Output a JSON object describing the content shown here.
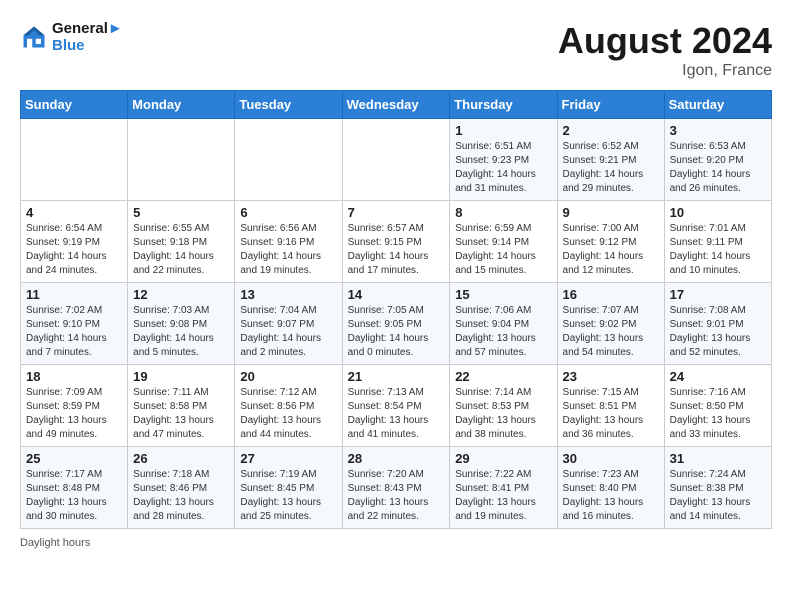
{
  "header": {
    "logo_line1": "General",
    "logo_line2": "Blue",
    "month_title": "August 2024",
    "location": "Igon, France"
  },
  "days_of_week": [
    "Sunday",
    "Monday",
    "Tuesday",
    "Wednesday",
    "Thursday",
    "Friday",
    "Saturday"
  ],
  "weeks": [
    [
      {
        "day": "",
        "info": ""
      },
      {
        "day": "",
        "info": ""
      },
      {
        "day": "",
        "info": ""
      },
      {
        "day": "",
        "info": ""
      },
      {
        "day": "1",
        "info": "Sunrise: 6:51 AM\nSunset: 9:23 PM\nDaylight: 14 hours\nand 31 minutes."
      },
      {
        "day": "2",
        "info": "Sunrise: 6:52 AM\nSunset: 9:21 PM\nDaylight: 14 hours\nand 29 minutes."
      },
      {
        "day": "3",
        "info": "Sunrise: 6:53 AM\nSunset: 9:20 PM\nDaylight: 14 hours\nand 26 minutes."
      }
    ],
    [
      {
        "day": "4",
        "info": "Sunrise: 6:54 AM\nSunset: 9:19 PM\nDaylight: 14 hours\nand 24 minutes."
      },
      {
        "day": "5",
        "info": "Sunrise: 6:55 AM\nSunset: 9:18 PM\nDaylight: 14 hours\nand 22 minutes."
      },
      {
        "day": "6",
        "info": "Sunrise: 6:56 AM\nSunset: 9:16 PM\nDaylight: 14 hours\nand 19 minutes."
      },
      {
        "day": "7",
        "info": "Sunrise: 6:57 AM\nSunset: 9:15 PM\nDaylight: 14 hours\nand 17 minutes."
      },
      {
        "day": "8",
        "info": "Sunrise: 6:59 AM\nSunset: 9:14 PM\nDaylight: 14 hours\nand 15 minutes."
      },
      {
        "day": "9",
        "info": "Sunrise: 7:00 AM\nSunset: 9:12 PM\nDaylight: 14 hours\nand 12 minutes."
      },
      {
        "day": "10",
        "info": "Sunrise: 7:01 AM\nSunset: 9:11 PM\nDaylight: 14 hours\nand 10 minutes."
      }
    ],
    [
      {
        "day": "11",
        "info": "Sunrise: 7:02 AM\nSunset: 9:10 PM\nDaylight: 14 hours\nand 7 minutes."
      },
      {
        "day": "12",
        "info": "Sunrise: 7:03 AM\nSunset: 9:08 PM\nDaylight: 14 hours\nand 5 minutes."
      },
      {
        "day": "13",
        "info": "Sunrise: 7:04 AM\nSunset: 9:07 PM\nDaylight: 14 hours\nand 2 minutes."
      },
      {
        "day": "14",
        "info": "Sunrise: 7:05 AM\nSunset: 9:05 PM\nDaylight: 14 hours\nand 0 minutes."
      },
      {
        "day": "15",
        "info": "Sunrise: 7:06 AM\nSunset: 9:04 PM\nDaylight: 13 hours\nand 57 minutes."
      },
      {
        "day": "16",
        "info": "Sunrise: 7:07 AM\nSunset: 9:02 PM\nDaylight: 13 hours\nand 54 minutes."
      },
      {
        "day": "17",
        "info": "Sunrise: 7:08 AM\nSunset: 9:01 PM\nDaylight: 13 hours\nand 52 minutes."
      }
    ],
    [
      {
        "day": "18",
        "info": "Sunrise: 7:09 AM\nSunset: 8:59 PM\nDaylight: 13 hours\nand 49 minutes."
      },
      {
        "day": "19",
        "info": "Sunrise: 7:11 AM\nSunset: 8:58 PM\nDaylight: 13 hours\nand 47 minutes."
      },
      {
        "day": "20",
        "info": "Sunrise: 7:12 AM\nSunset: 8:56 PM\nDaylight: 13 hours\nand 44 minutes."
      },
      {
        "day": "21",
        "info": "Sunrise: 7:13 AM\nSunset: 8:54 PM\nDaylight: 13 hours\nand 41 minutes."
      },
      {
        "day": "22",
        "info": "Sunrise: 7:14 AM\nSunset: 8:53 PM\nDaylight: 13 hours\nand 38 minutes."
      },
      {
        "day": "23",
        "info": "Sunrise: 7:15 AM\nSunset: 8:51 PM\nDaylight: 13 hours\nand 36 minutes."
      },
      {
        "day": "24",
        "info": "Sunrise: 7:16 AM\nSunset: 8:50 PM\nDaylight: 13 hours\nand 33 minutes."
      }
    ],
    [
      {
        "day": "25",
        "info": "Sunrise: 7:17 AM\nSunset: 8:48 PM\nDaylight: 13 hours\nand 30 minutes."
      },
      {
        "day": "26",
        "info": "Sunrise: 7:18 AM\nSunset: 8:46 PM\nDaylight: 13 hours\nand 28 minutes."
      },
      {
        "day": "27",
        "info": "Sunrise: 7:19 AM\nSunset: 8:45 PM\nDaylight: 13 hours\nand 25 minutes."
      },
      {
        "day": "28",
        "info": "Sunrise: 7:20 AM\nSunset: 8:43 PM\nDaylight: 13 hours\nand 22 minutes."
      },
      {
        "day": "29",
        "info": "Sunrise: 7:22 AM\nSunset: 8:41 PM\nDaylight: 13 hours\nand 19 minutes."
      },
      {
        "day": "30",
        "info": "Sunrise: 7:23 AM\nSunset: 8:40 PM\nDaylight: 13 hours\nand 16 minutes."
      },
      {
        "day": "31",
        "info": "Sunrise: 7:24 AM\nSunset: 8:38 PM\nDaylight: 13 hours\nand 14 minutes."
      }
    ]
  ],
  "footer": {
    "note": "Daylight hours"
  }
}
